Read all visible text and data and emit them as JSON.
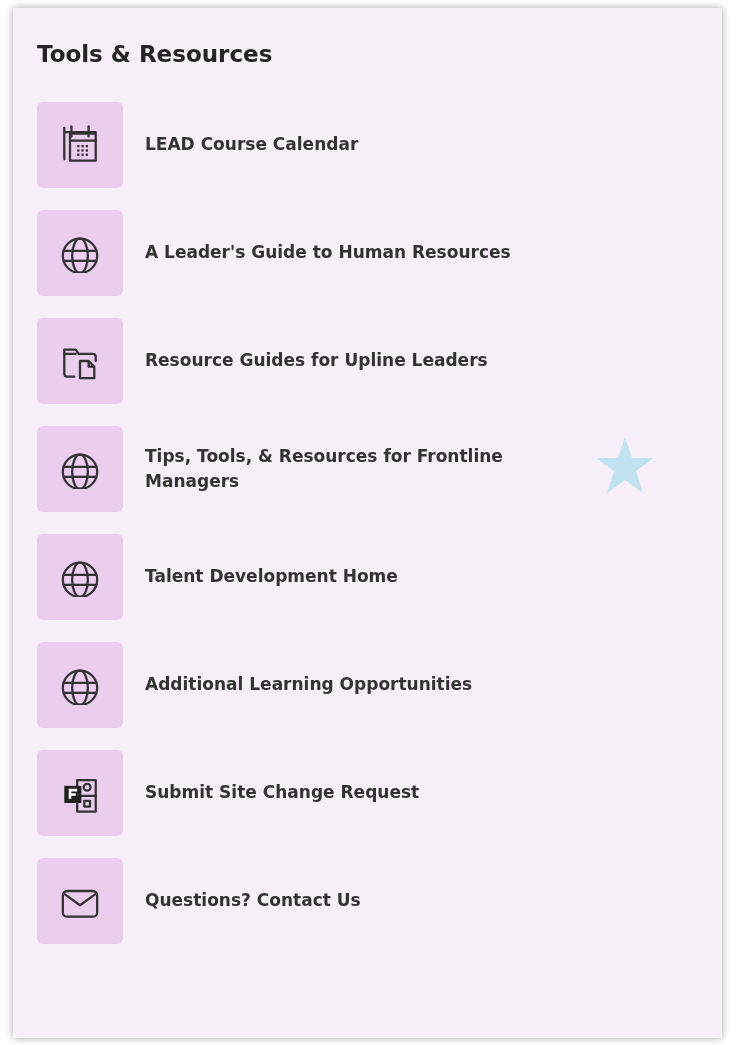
{
  "panel": {
    "title": "Tools & Resources",
    "links": [
      {
        "label": "LEAD Course Calendar",
        "kind": "calendar"
      },
      {
        "label": "A Leader's Guide to Human Resources",
        "kind": "globe"
      },
      {
        "label": "Resource Guides for Upline Leaders",
        "kind": "folder"
      },
      {
        "label": "Tips, Tools, & Resources for Frontline Managers",
        "kind": "globe"
      },
      {
        "label": "Talent Development Home",
        "kind": "globe"
      },
      {
        "label": "Additional Learning Opportunities",
        "kind": "globe"
      },
      {
        "label": "Submit Site Change Request",
        "kind": "form"
      },
      {
        "label": "Questions? Contact Us",
        "kind": "mail"
      }
    ]
  }
}
